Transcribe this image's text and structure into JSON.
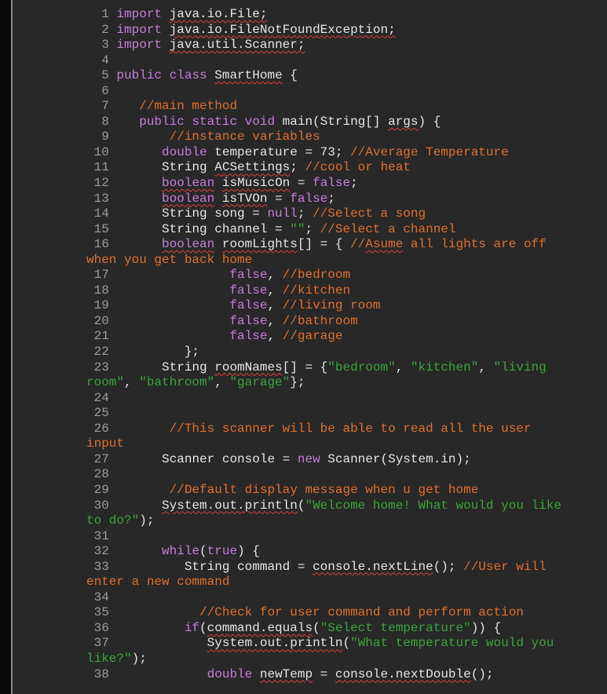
{
  "editor": {
    "language": "java",
    "rows": [
      {
        "num": "1",
        "indent": 0,
        "tokens": [
          [
            "kw",
            "import"
          ],
          [
            "tx",
            " "
          ],
          [
            "tx sq",
            "java.io.File;"
          ]
        ]
      },
      {
        "num": "2",
        "indent": 0,
        "tokens": [
          [
            "kw",
            "import"
          ],
          [
            "tx",
            " "
          ],
          [
            "tx sq",
            "java.io.FileNotFoundException;"
          ]
        ]
      },
      {
        "num": "3",
        "indent": 0,
        "tokens": [
          [
            "kw",
            "import"
          ],
          [
            "tx",
            " "
          ],
          [
            "tx sq",
            "java.util.Scanner;"
          ]
        ]
      },
      {
        "num": "4",
        "indent": 0,
        "tokens": []
      },
      {
        "num": "5",
        "indent": 0,
        "tokens": [
          [
            "kw",
            "public class"
          ],
          [
            "tx",
            " "
          ],
          [
            "tx sq",
            "SmartHome"
          ],
          [
            "tx",
            " {"
          ]
        ]
      },
      {
        "num": "6",
        "indent": 0,
        "tokens": []
      },
      {
        "num": "7",
        "indent": 3,
        "tokens": [
          [
            "cm",
            "//main method"
          ]
        ]
      },
      {
        "num": "8",
        "indent": 3,
        "tokens": [
          [
            "kw",
            "public static void"
          ],
          [
            "tx",
            " main(String[] "
          ],
          [
            "tx sq",
            "args"
          ],
          [
            "tx",
            ") {"
          ]
        ]
      },
      {
        "num": "9",
        "indent": 7,
        "tokens": [
          [
            "cm",
            "//instance variables"
          ]
        ]
      },
      {
        "num": "10",
        "indent": 6,
        "tokens": [
          [
            "kw",
            "double"
          ],
          [
            "tx",
            " temperature = 73; "
          ],
          [
            "cm",
            "//Average Temperature"
          ]
        ]
      },
      {
        "num": "11",
        "indent": 6,
        "tokens": [
          [
            "tx",
            "String "
          ],
          [
            "tx sq",
            "ACSettings"
          ],
          [
            "tx",
            "; "
          ],
          [
            "cm",
            "//cool or heat"
          ]
        ]
      },
      {
        "num": "12",
        "indent": 6,
        "tokens": [
          [
            "kw sq",
            "boolean"
          ],
          [
            "tx",
            " "
          ],
          [
            "tx sq",
            "isMusicOn"
          ],
          [
            "tx",
            " = "
          ],
          [
            "kw",
            "false"
          ],
          [
            "tx",
            ";"
          ]
        ]
      },
      {
        "num": "13",
        "indent": 6,
        "tokens": [
          [
            "kw sq",
            "boolean"
          ],
          [
            "tx",
            " "
          ],
          [
            "tx sq",
            "isTVOn"
          ],
          [
            "tx",
            " = "
          ],
          [
            "kw",
            "false"
          ],
          [
            "tx",
            ";"
          ]
        ]
      },
      {
        "num": "14",
        "indent": 6,
        "tokens": [
          [
            "tx",
            "String song = "
          ],
          [
            "kw",
            "null"
          ],
          [
            "tx",
            "; "
          ],
          [
            "cm",
            "//Select a song"
          ]
        ]
      },
      {
        "num": "15",
        "indent": 6,
        "tokens": [
          [
            "tx",
            "String channel = "
          ],
          [
            "str",
            "\"\""
          ],
          [
            "tx",
            "; "
          ],
          [
            "cm",
            "//Select a channel"
          ]
        ]
      },
      {
        "num": "16",
        "indent": 6,
        "tokens": [
          [
            "kw sq",
            "boolean"
          ],
          [
            "tx",
            " "
          ],
          [
            "tx sq",
            "roomLights"
          ],
          [
            "tx",
            "[] = { "
          ],
          [
            "cm",
            "//"
          ],
          [
            "cm sq",
            "Asume"
          ],
          [
            "cm",
            " all lights are off"
          ]
        ]
      },
      {
        "num": "",
        "wrap": true,
        "tokens": [
          [
            "cm",
            "when you get back home"
          ]
        ]
      },
      {
        "num": "17",
        "indent": 15,
        "tokens": [
          [
            "kw",
            "false"
          ],
          [
            "tx",
            ", "
          ],
          [
            "cm",
            "//bedroom"
          ]
        ]
      },
      {
        "num": "18",
        "indent": 15,
        "tokens": [
          [
            "kw",
            "false"
          ],
          [
            "tx",
            ", "
          ],
          [
            "cm",
            "//kitchen"
          ]
        ]
      },
      {
        "num": "19",
        "indent": 15,
        "tokens": [
          [
            "kw",
            "false"
          ],
          [
            "tx",
            ", "
          ],
          [
            "cm",
            "//living room"
          ]
        ]
      },
      {
        "num": "20",
        "indent": 15,
        "tokens": [
          [
            "kw",
            "false"
          ],
          [
            "tx",
            ", "
          ],
          [
            "cm",
            "//bathroom"
          ]
        ]
      },
      {
        "num": "21",
        "indent": 15,
        "tokens": [
          [
            "kw",
            "false"
          ],
          [
            "tx",
            ", "
          ],
          [
            "cm",
            "//garage"
          ]
        ]
      },
      {
        "num": "22",
        "indent": 9,
        "tokens": [
          [
            "tx",
            "};"
          ]
        ]
      },
      {
        "num": "23",
        "indent": 6,
        "tokens": [
          [
            "tx",
            "String "
          ],
          [
            "tx sq",
            "roomNames"
          ],
          [
            "tx",
            "[] = {"
          ],
          [
            "str",
            "\"bedroom\""
          ],
          [
            "tx",
            ", "
          ],
          [
            "str",
            "\"kitchen\""
          ],
          [
            "tx",
            ", "
          ],
          [
            "str",
            "\"living"
          ]
        ]
      },
      {
        "num": "",
        "wrap": true,
        "tokens": [
          [
            "str",
            "room\""
          ],
          [
            "tx",
            ", "
          ],
          [
            "str",
            "\"bathroom\""
          ],
          [
            "tx",
            ", "
          ],
          [
            "str",
            "\"garage\""
          ],
          [
            "tx",
            "};"
          ]
        ]
      },
      {
        "num": "24",
        "indent": 0,
        "tokens": []
      },
      {
        "num": "25",
        "indent": 0,
        "tokens": []
      },
      {
        "num": "26",
        "indent": 7,
        "tokens": [
          [
            "cm",
            "//This scanner will be able to read all the user"
          ]
        ]
      },
      {
        "num": "",
        "wrap": true,
        "tokens": [
          [
            "cm",
            "input"
          ]
        ]
      },
      {
        "num": "27",
        "indent": 6,
        "tokens": [
          [
            "tx",
            "Scanner console = "
          ],
          [
            "kw",
            "new"
          ],
          [
            "tx",
            " Scanner(System.in);"
          ]
        ]
      },
      {
        "num": "28",
        "indent": 0,
        "tokens": []
      },
      {
        "num": "29",
        "indent": 7,
        "tokens": [
          [
            "cm",
            "//Default display message when u get home"
          ]
        ]
      },
      {
        "num": "30",
        "indent": 6,
        "tokens": [
          [
            "tx sq",
            "System.out.println"
          ],
          [
            "tx",
            "("
          ],
          [
            "str",
            "\"Welcome home! What would you like"
          ]
        ]
      },
      {
        "num": "",
        "wrap": true,
        "tokens": [
          [
            "str",
            "to do?\""
          ],
          [
            "tx",
            ");"
          ]
        ]
      },
      {
        "num": "31",
        "indent": 0,
        "tokens": []
      },
      {
        "num": "32",
        "indent": 6,
        "tokens": [
          [
            "kw",
            "while"
          ],
          [
            "tx",
            "("
          ],
          [
            "kw",
            "true"
          ],
          [
            "tx",
            ") {"
          ]
        ]
      },
      {
        "num": "33",
        "indent": 9,
        "tokens": [
          [
            "tx",
            "String command = "
          ],
          [
            "tx sq",
            "console.nextLine"
          ],
          [
            "tx",
            "(); "
          ],
          [
            "cm",
            "//User will"
          ]
        ]
      },
      {
        "num": "",
        "wrap": true,
        "tokens": [
          [
            "cm",
            "enter a new command"
          ]
        ]
      },
      {
        "num": "34",
        "indent": 0,
        "tokens": []
      },
      {
        "num": "35",
        "indent": 11,
        "tokens": [
          [
            "cm",
            "//Check for user command and perform action"
          ]
        ]
      },
      {
        "num": "36",
        "indent": 9,
        "tokens": [
          [
            "kw",
            "if"
          ],
          [
            "tx",
            "("
          ],
          [
            "tx sq",
            "command.equals"
          ],
          [
            "tx",
            "("
          ],
          [
            "str",
            "\"Select temperature\""
          ],
          [
            "tx",
            ")) {"
          ]
        ]
      },
      {
        "num": "37",
        "indent": 12,
        "tokens": [
          [
            "tx sq",
            "System.out.println"
          ],
          [
            "tx",
            "("
          ],
          [
            "str",
            "\"What temperature would you"
          ]
        ]
      },
      {
        "num": "",
        "wrap": true,
        "tokens": [
          [
            "str",
            "like?\""
          ],
          [
            "tx",
            ");"
          ]
        ]
      },
      {
        "num": "38",
        "indent": 12,
        "tokens": [
          [
            "kw",
            "double"
          ],
          [
            "tx",
            " "
          ],
          [
            "tx sq",
            "newTemp"
          ],
          [
            "tx",
            " = "
          ],
          [
            "tx sq",
            "console.nextDouble"
          ],
          [
            "tx",
            "();"
          ]
        ]
      }
    ]
  }
}
